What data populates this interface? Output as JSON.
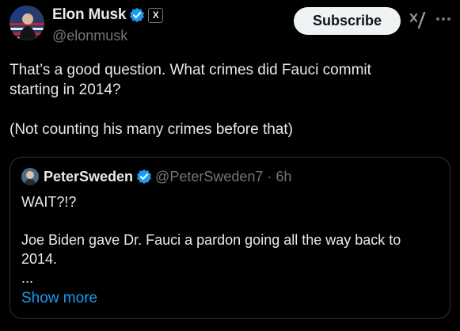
{
  "author": {
    "name": "Elon Musk",
    "handle": "@elonmusk",
    "affiliate_badge": "X"
  },
  "actions": {
    "subscribe_label": "Subscribe"
  },
  "icons": {
    "verified": "verified-badge-icon",
    "grok": "grok-icon",
    "more": "more-options-icon"
  },
  "tweet": {
    "text": "That’s a good question. What crimes did Fauci commit\nstarting in 2014?\n\n(Not counting his many crimes before that)"
  },
  "quote": {
    "name": "PeterSweden",
    "handle_time": "@PeterSweden7 · 6h",
    "text": "WAIT?!?\n\nJoe Biden gave Dr. Fauci a pardon going all the way back to\n2014.\n...",
    "show_more": "Show more"
  },
  "colors": {
    "background": "#000000",
    "text": "#e7e9ea",
    "muted": "#71767b",
    "link": "#1d9bf0",
    "verified": "#1d9bf0",
    "border": "#2f3336"
  }
}
